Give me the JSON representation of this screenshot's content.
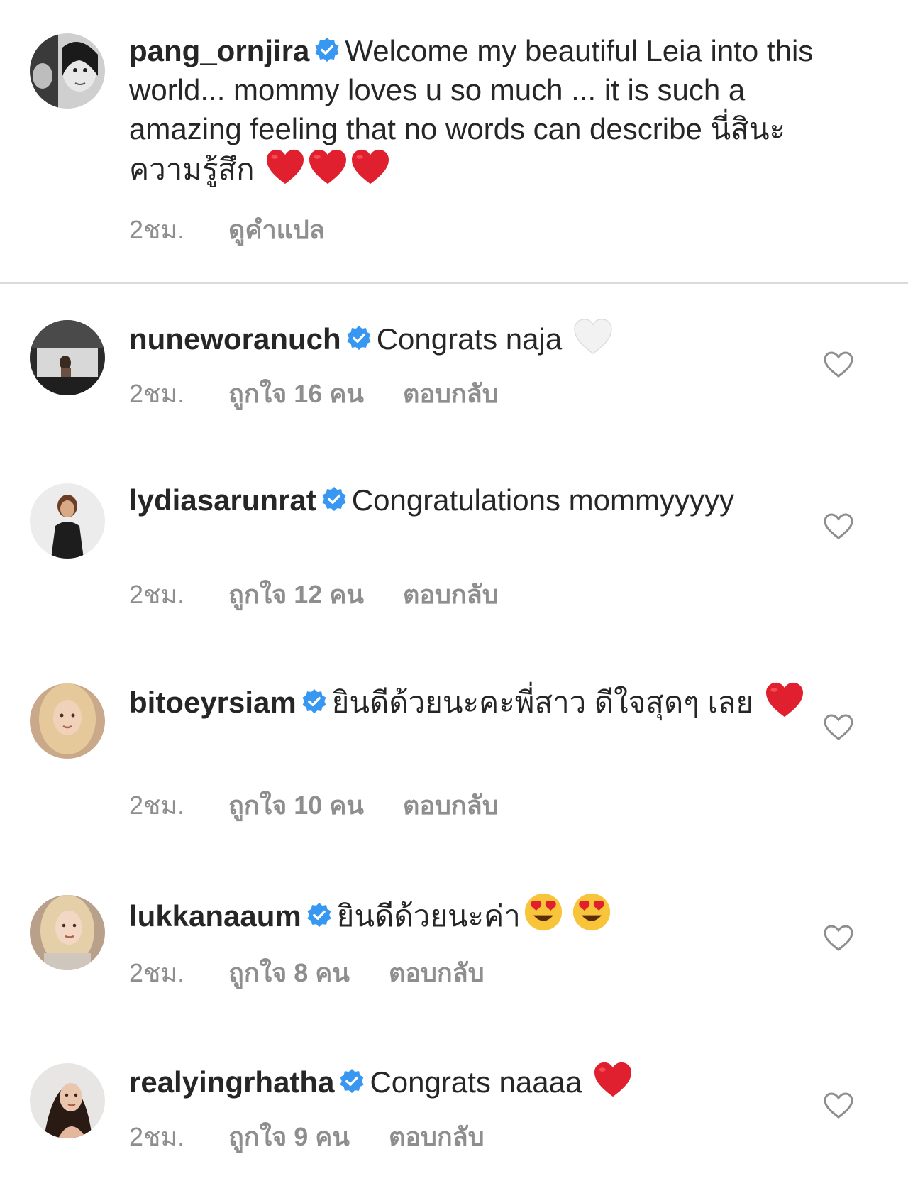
{
  "caption": {
    "username": "pang_ornjira",
    "text": "Welcome my beautiful Leia into this world... mommy loves u so much ... it is such a amazing feeling that no words can describe นี่สินะ ความรู้สึก",
    "emojis": [
      "red-heart-emoji",
      "red-heart-emoji",
      "red-heart-emoji"
    ],
    "time": "2ชม.",
    "translate_label": "ดูคำแปล"
  },
  "comments": [
    {
      "username": "nuneworanuch",
      "text": "Congrats naja",
      "emojis": [
        "white-heart-emoji"
      ],
      "time": "2ชม.",
      "likes": "ถูกใจ 16 คน",
      "reply": "ตอบกลับ"
    },
    {
      "username": "lydiasarunrat",
      "text": "Congratulations mommyyyyy",
      "emojis": [],
      "time": "2ชม.",
      "likes": "ถูกใจ 12 คน",
      "reply": "ตอบกลับ"
    },
    {
      "username": "bitoeyrsiam",
      "text": "ยินดีด้วยนะคะพี่สาว ดีใจสุดๆ เลย",
      "emojis": [
        "red-heart-emoji"
      ],
      "time": "2ชม.",
      "likes": "ถูกใจ 10 คน",
      "reply": "ตอบกลับ"
    },
    {
      "username": "lukkanaaum",
      "text": "ยินดีด้วยนะค่า",
      "emojis": [
        "heart-eyes-emoji",
        "heart-eyes-emoji"
      ],
      "time": "2ชม.",
      "likes": "ถูกใจ 8 คน",
      "reply": "ตอบกลับ"
    },
    {
      "username": "realyingrhatha",
      "text": "Congrats naaaa",
      "emojis": [
        "red-heart-emoji"
      ],
      "time": "2ชม.",
      "likes": "ถูกใจ 9 คน",
      "reply": "ตอบกลับ"
    }
  ],
  "colors": {
    "text": "#262626",
    "secondary": "#8e8e8e",
    "verified": "#3897f0",
    "heart": "#e0202e",
    "divider": "#dbdbdb"
  }
}
